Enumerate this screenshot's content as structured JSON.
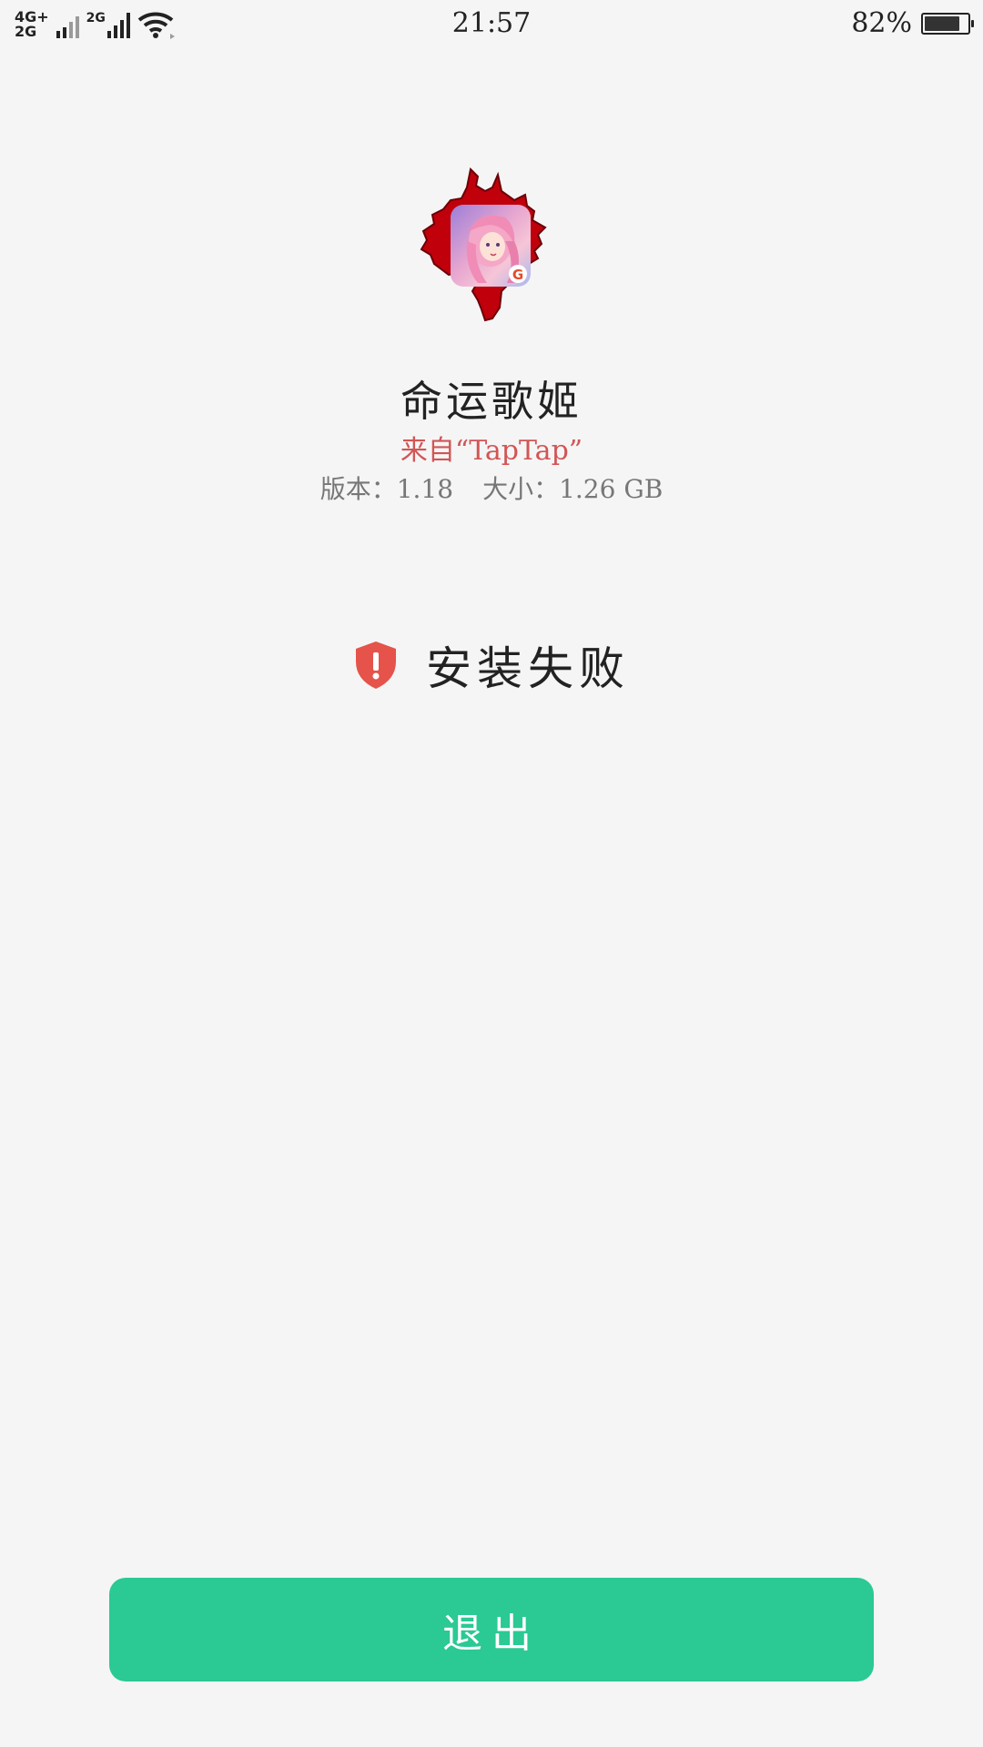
{
  "status_bar": {
    "network_primary": "4G+",
    "network_primary_sub": "2G",
    "network_secondary": "2G",
    "time": "21:57",
    "battery_percent": "82%",
    "battery_level": 0.82
  },
  "app": {
    "name": "命运歌姬",
    "source": "来自“TapTap”",
    "version_label": "版本：1.18",
    "size_label": "大小：1.26 GB"
  },
  "result": {
    "status_text": "安装失败",
    "icon": "shield-alert-icon",
    "icon_color": "#e5534b"
  },
  "actions": {
    "exit_label": "退出",
    "exit_color": "#2bc994"
  }
}
